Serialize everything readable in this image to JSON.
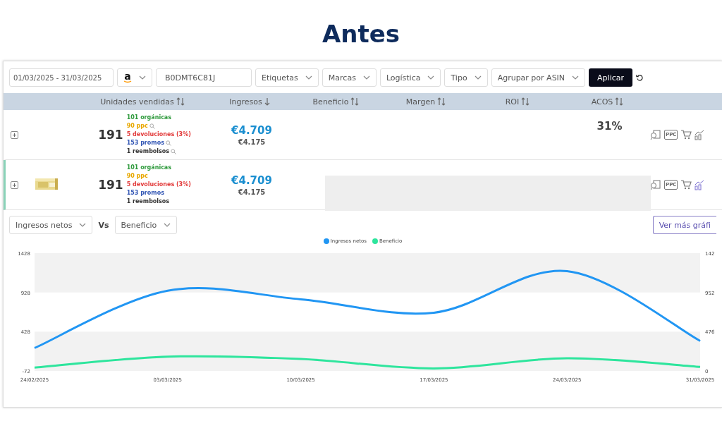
{
  "title": "Antes",
  "filters": {
    "date_range": "01/03/2025 - 31/03/2025",
    "marketplace": "a",
    "asin": "B0DMT6C81J",
    "dropdowns": [
      "Etiquetas",
      "Marcas",
      "Logística",
      "Tipo",
      "Agrupar por ASIN"
    ],
    "apply": "Aplicar"
  },
  "table": {
    "columns": [
      {
        "label": "Unidades vendidas",
        "sorted_desc": false
      },
      {
        "label": "Ingresos",
        "sorted_desc": true
      },
      {
        "label": "Beneficio",
        "sorted_desc": false
      },
      {
        "label": "Margen",
        "sorted_desc": false
      },
      {
        "label": "ROI",
        "sorted_desc": false
      },
      {
        "label": "ACOS",
        "sorted_desc": false
      }
    ],
    "rows": [
      {
        "selected": false,
        "thumbnail": false,
        "placeholder": false,
        "units": "191",
        "breakdown": [
          {
            "text": "101 orgánicas",
            "color": "#2e9a3c",
            "search": false
          },
          {
            "text": "90 ppc",
            "color": "#e8a800",
            "search": true
          },
          {
            "text": "5 devoluciones (3%)",
            "color": "#e23b3b",
            "search": false
          },
          {
            "text": "153 promos",
            "color": "#3357b5",
            "search": true
          },
          {
            "text": "1 reembolsos",
            "color": "#333333",
            "search": true
          }
        ],
        "revenue": "€4.709",
        "revenue_net": "€4.175",
        "acos": "31%",
        "ppc": "PPC"
      },
      {
        "selected": true,
        "thumbnail": true,
        "placeholder": true,
        "units": "191",
        "breakdown": [
          {
            "text": "101 orgánicas",
            "color": "#2e9a3c",
            "search": false
          },
          {
            "text": "90 ppc",
            "color": "#e8a800",
            "search": false
          },
          {
            "text": "5 devoluciones (3%)",
            "color": "#e23b3b",
            "search": false
          },
          {
            "text": "153 promos",
            "color": "#3357b5",
            "search": false
          },
          {
            "text": "1 reembolsos",
            "color": "#333333",
            "search": false
          }
        ],
        "revenue": "€4.709",
        "revenue_net": "€4.175",
        "ppc": "PPC"
      }
    ]
  },
  "chart_section": {
    "metric_a": "Ingresos netos",
    "vs": "Vs",
    "metric_b": "Beneficio",
    "more_button": "Ver más gráfi",
    "chart_data": {
      "type": "line",
      "x": [
        "24/02/2025",
        "03/03/2025",
        "10/03/2025",
        "17/03/2025",
        "24/03/2025",
        "31/03/2025"
      ],
      "ylim": [
        -72,
        1428
      ],
      "yticks": [
        -72,
        428,
        928,
        1428
      ],
      "series": [
        {
          "name": "Ingresos netos",
          "color": "#2196f3",
          "values": [
            220,
            950,
            840,
            670,
            1200,
            310
          ]
        },
        {
          "name": "Beneficio",
          "color": "#2ee59d",
          "values": [
            -30,
            110,
            80,
            -40,
            90,
            -20
          ]
        }
      ]
    },
    "right_axis_labels": [
      "142",
      "952",
      "476",
      "0"
    ]
  }
}
